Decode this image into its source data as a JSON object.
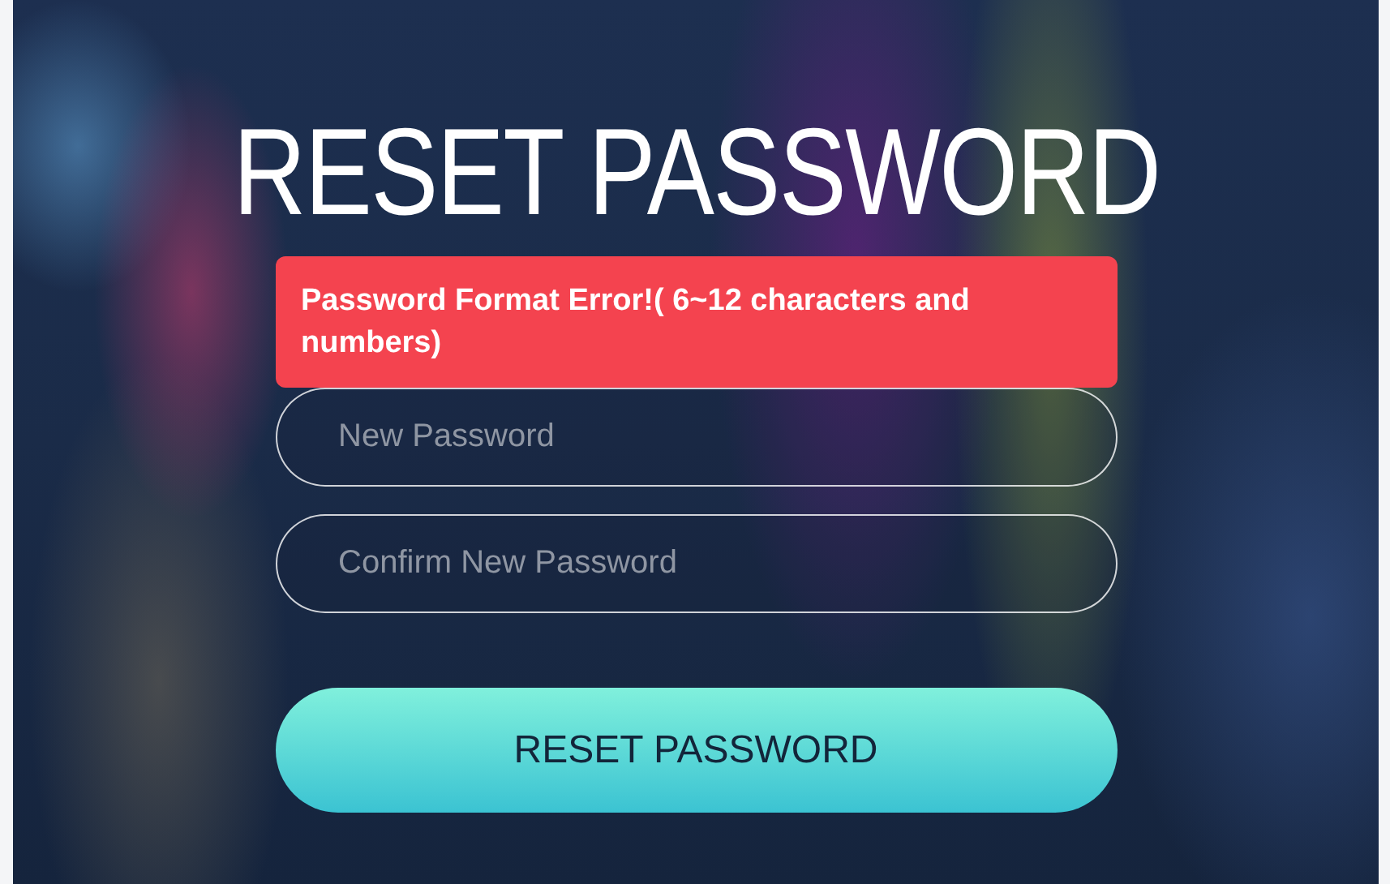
{
  "title": "RESET PASSWORD",
  "error_message": "Password Format Error!( 6~12 characters and numbers)",
  "fields": [
    {
      "placeholder": "New Password"
    },
    {
      "placeholder": "Confirm New Password"
    }
  ],
  "submit_button": "RESET PASSWORD"
}
